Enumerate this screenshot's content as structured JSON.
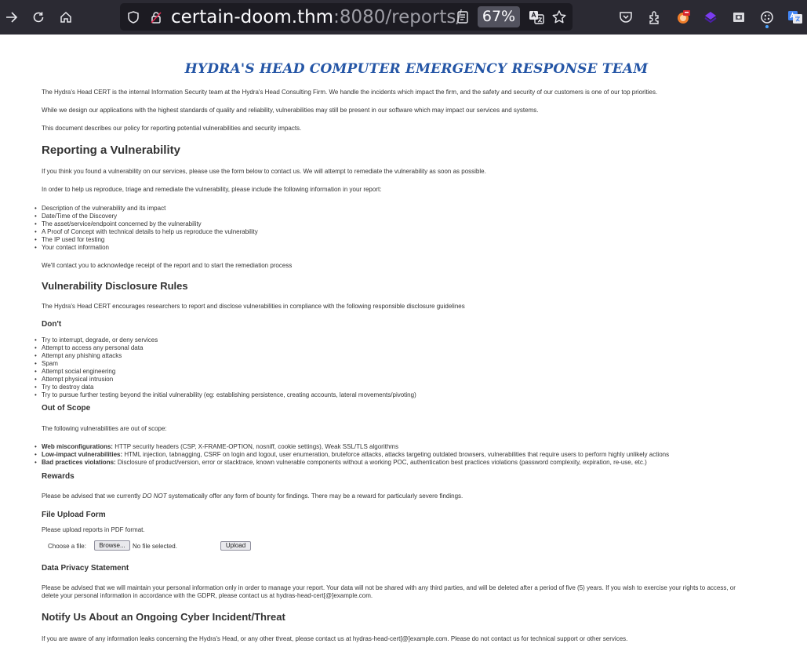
{
  "browser": {
    "url_host": "certain-doom.thm",
    "url_rest": ":8080/reports/",
    "zoom": "67%",
    "icons": [
      "back-arrow-icon",
      "reload-icon",
      "home-icon",
      "shield-icon",
      "lock-icon",
      "reader-view-icon",
      "translate-icon",
      "bookmark-star-icon",
      "pocket-icon",
      "extensions-icon",
      "burp-extension-icon",
      "wappalyzer-extension-icon",
      "extension-icon",
      "cookie-extension-icon",
      "translate-extension-icon"
    ]
  },
  "page": {
    "title": "HYDRA'S HEAD COMPUTER EMERGENCY RESPONSE TEAM",
    "intro": [
      "The Hydra's Head CERT is the internal Information Security team at the Hydra's Head Consulting Firm. We handle the incidents which impact the firm, and the safety and security of our customers is one of our top priorities.",
      "While we design our applications with the highest standards of quality and reliability, vulnerabilities may still be present in our software which may impact our services and systems.",
      "This document describes our policy for reporting potential vulnerabilities and security impacts."
    ],
    "reporting": {
      "heading": "Reporting a Vulnerability",
      "p1": "If you think you found a vulnerability on our services, please use the form below to contact us. We will attempt to remediate the vulnerability as soon as possible.",
      "p2": "In order to help us reproduce, triage and remediate the vulnerability, please include the following information in your report:",
      "items": [
        "Description of the vulnerability and its impact",
        "Date/Time of the Discovery",
        "The asset/service/endpoint concerned by the vulnerability",
        "A Proof of Concept with technical details to help us reproduce the vulnerability",
        "The IP used for testing",
        "Your contact information"
      ],
      "p3": "We'll contact you to acknowledge receipt of the report and to start the remediation process"
    },
    "rules": {
      "heading": "Vulnerability Disclosure Rules",
      "p1": "The Hydra's Head CERT encourages researchers to report and disclose vulnerabilities in compliance with the following responsible disclosure guidelines",
      "dont_heading": "Don't",
      "dont_items": [
        "Try to interrupt, degrade, or deny services",
        "Attempt to access any personal data",
        "Attempt any phishing attacks",
        "Spam",
        "Attempt social engineering",
        "Attempt physical intrusion",
        "Try to destroy data",
        "Try to pursue further testing beyond the initial vulnerability (eg: establishing persistence, creating accounts, lateral movements/pivoting)"
      ]
    },
    "scope": {
      "heading": "Out of Scope",
      "p1": "The following vulnerabilities are out of scope:",
      "items": [
        {
          "label": "Web misconfigurations:",
          "text": " HTTP security headers (CSP, X-FRAME-OPTION, nosniff, cookie settings), Weak SSL/TLS algorithms"
        },
        {
          "label": "Low-impact vulnerabilities:",
          "text": " HTML injection, tabnagging, CSRF on login and logout, user enumeration, bruteforce attacks, attacks targeting outdated browsers, vulnerabilities that require users to perform highly unlikely actions"
        },
        {
          "label": "Bad practices violations:",
          "text": " Disclosure of product/version, error or stacktrace, known vulnerable components without a working POC, authentication best practices violations (password complexity, expiration, re-use, etc.)"
        }
      ]
    },
    "rewards": {
      "heading": "Rewards",
      "pre": "Please be advised that we currently ",
      "em": "DO NOT",
      "post": " systematically offer any form of bounty for findings. There may be a reward for particularly severe findings."
    },
    "upload": {
      "heading": "File Upload Form",
      "p1": "Please upload reports in PDF format.",
      "choose_label": "Choose a file:",
      "browse_label": "Browse...",
      "file_status": "No file selected.",
      "upload_label": "Upload"
    },
    "privacy": {
      "heading": "Data Privacy Statement",
      "line1": "Please be advised that we will maintain your personal information only in order to manage your report. Your data will not be shared with any third parties, and will be deleted after a period of five (5) years. If you wish to exercise your rights to access, or",
      "line2": "delete your personal information in accordance with the GDPR, please contact us at hydras-head-cert[@]example.com."
    },
    "notify": {
      "heading": "Notify Us About an Ongoing Cyber Incident/Threat",
      "p1": "If you are aware of any information leaks concerning the Hydra's Head, or any other threat, please contact us at hydras-head-cert[@]example.com. Please do not contact us for technical support or other services."
    }
  }
}
